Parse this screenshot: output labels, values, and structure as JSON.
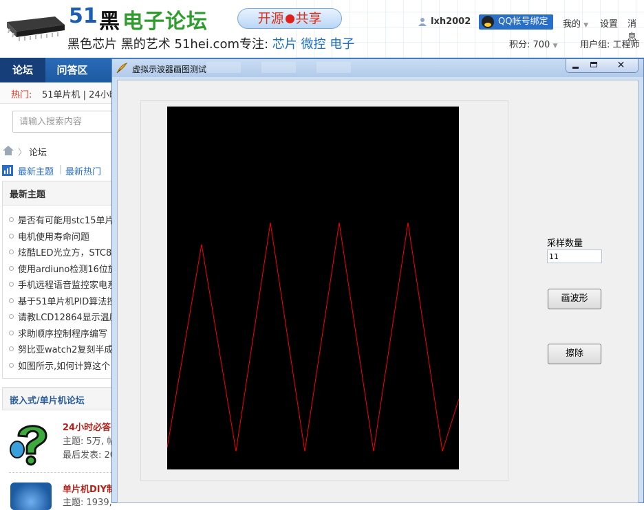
{
  "forum": {
    "logo_num": "51",
    "logo_black": "黑",
    "logo_green": "电子论坛",
    "slogan_left": "开源",
    "slogan_right": "共享",
    "tagline_prefix": "黑色芯片 黑的艺术  51hei.com专注:",
    "tagline_t1": "芯片",
    "tagline_t2": "微控",
    "tagline_t3": "电子",
    "username": "lxh2002",
    "qq_bind": "QQ帐号绑定",
    "my": "我的",
    "settings": "设置",
    "messages": "消息",
    "points": "积分: 700",
    "usergroup": "用户组: 工程师",
    "nav_forum": "论坛",
    "nav_qa": "问答区",
    "hot_label": "热门:",
    "hot_text": "51单片机 | 24小时",
    "search_placeholder": "请输入搜索内容",
    "breadcrumb": "论坛",
    "tab_latest": "最新主题",
    "tab_hot": "最新热门",
    "latest_title": "最新主题",
    "topics": [
      "是否有可能用stc15单片",
      "电机使用寿命问题",
      "炫酷LED光立方，STC8H",
      "使用ardiuno检测16位旋",
      "手机远程语音监控家电系",
      "基于51单片机PID算法控",
      "请教LCD12864显示温度",
      "求助顺序控制程序编写",
      "努比亚watch2复刻半成品",
      "如图所示,如何计算这个"
    ],
    "board_section": "嵌入式/单片机论坛",
    "board1_title": "24小时必答区",
    "board1_stat": "主题: 5万, 帖",
    "board1_last": "最后发表: 20",
    "board2_title": "单片机DIY制作",
    "board2_stat": "主题: 1939,"
  },
  "dialog": {
    "title": "虚拟示波器画图测试",
    "sample_label": "采样数量",
    "sample_value": "11",
    "draw_button": "画波形",
    "erase_button": "擦除",
    "wave_color": "#ff0000",
    "wave_background": "#000000"
  },
  "chart_data": {
    "type": "line",
    "title": "",
    "xlabel": "",
    "ylabel": "",
    "sample_count": 11,
    "series": [
      {
        "values": [
          0.06,
          0.62,
          0.05,
          0.68,
          0.05,
          0.68,
          0.05,
          0.68,
          0.05,
          0.35
        ]
      }
    ],
    "ylim": [
      0,
      1
    ],
    "grid": false
  }
}
